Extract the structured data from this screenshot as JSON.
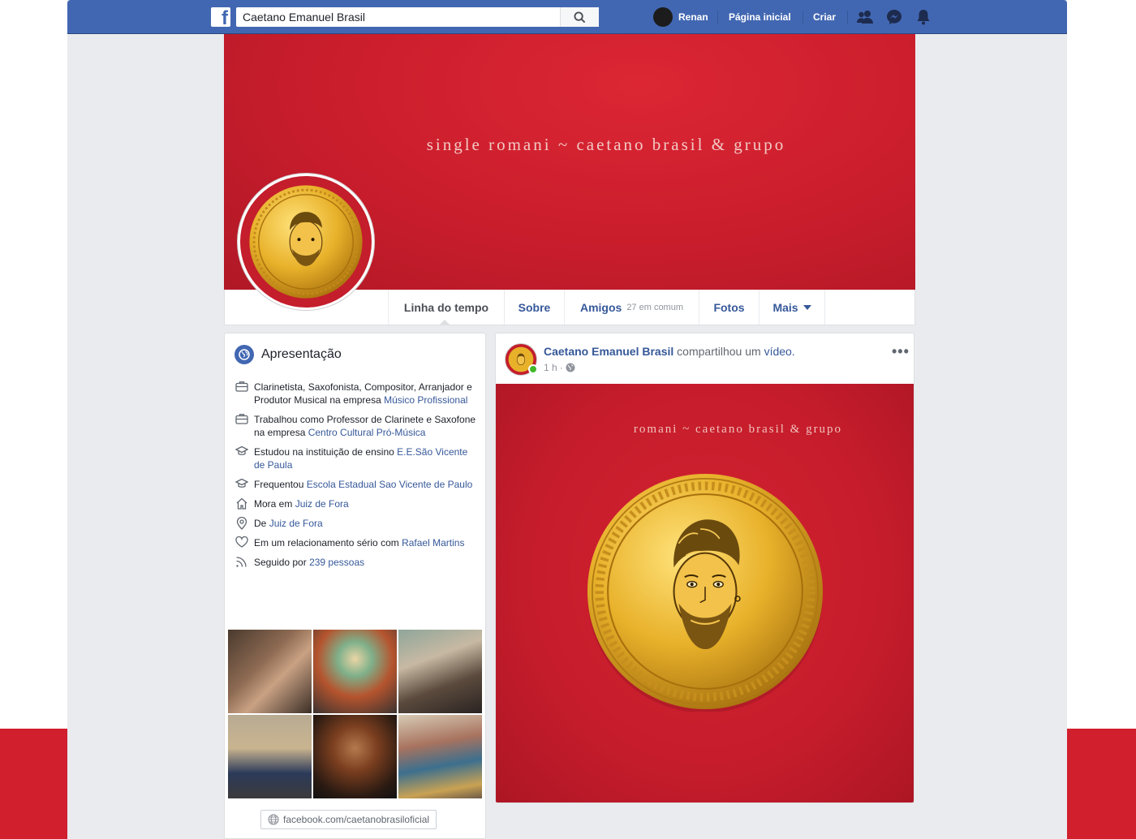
{
  "topbar": {
    "logo_letter": "f",
    "search_value": "Caetano Emanuel Brasil",
    "user_name": "Renan",
    "home_label": "Página inicial",
    "create_label": "Criar"
  },
  "cover": {
    "title": "single romani ~ caetano brasil & grupo"
  },
  "tabs": {
    "timeline": "Linha do tempo",
    "about": "Sobre",
    "friends": "Amigos",
    "friends_sub": "27 em comum",
    "photos": "Fotos",
    "more": "Mais"
  },
  "intro": {
    "title": "Apresentação",
    "items": [
      {
        "icon": "briefcase-icon",
        "text": "Clarinetista, Saxofonista, Compositor, Arranjador e Produtor Musical na empresa ",
        "link": "Músico Profissional"
      },
      {
        "icon": "briefcase-icon",
        "text": "Trabalhou como Professor de Clarinete e Saxofone na empresa ",
        "link": "Centro Cultural Pró-Música"
      },
      {
        "icon": "graduation-cap-icon",
        "text": "Estudou na instituição de ensino ",
        "link": "E.E.São Vicente de Paula"
      },
      {
        "icon": "graduation-cap-icon",
        "text": "Frequentou ",
        "link": "Escola Estadual Sao Vicente de Paulo"
      },
      {
        "icon": "home-icon",
        "text": "Mora em ",
        "link": "Juiz de Fora"
      },
      {
        "icon": "location-pin-icon",
        "text": "De ",
        "link": "Juiz de Fora"
      },
      {
        "icon": "heart-icon",
        "text": "Em um relacionamento sério com ",
        "link": "Rafael Martins"
      },
      {
        "icon": "rss-feed-icon",
        "text": "Seguido por ",
        "link": "239 pessoas"
      }
    ],
    "website": "facebook.com/caetanobrasiloficial"
  },
  "post": {
    "author": "Caetano Emanuel Brasil",
    "action_text": " compartilhou um ",
    "action_link": "vídeo.",
    "time": "1 h",
    "meta_sep": "·",
    "more_label": "•••",
    "media_title": "romani ~ caetano brasil & grupo"
  },
  "colors": {
    "brand": "#4267b2",
    "cover_red": "#c91d2c",
    "coin_gold": "#e8b12a",
    "link": "#365899"
  }
}
